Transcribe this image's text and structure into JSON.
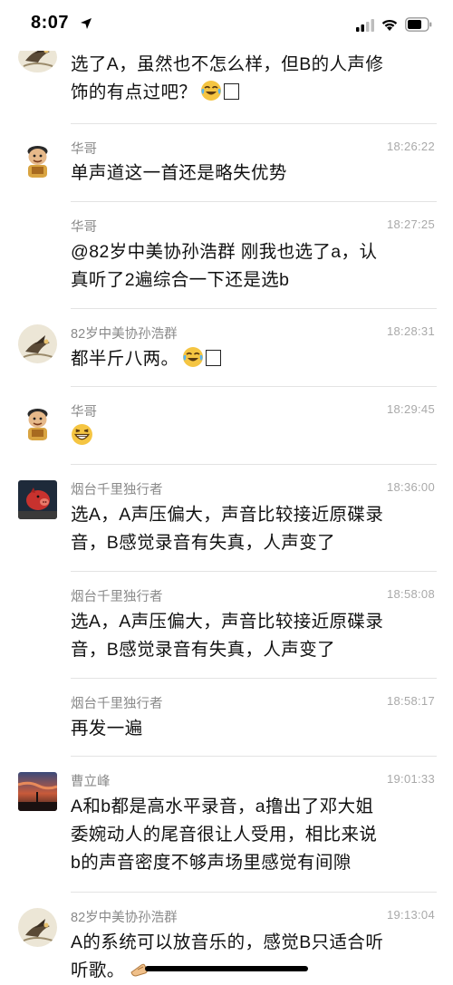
{
  "status_bar": {
    "time": "8:07"
  },
  "messages": [
    {
      "sender": "",
      "time": "",
      "lines": [
        "选了A，虽然也不怎么样，但B的人声修",
        "饰的有点过吧？"
      ],
      "avatar": "bird-avatar",
      "trail": [
        "crying-laughing-emoji",
        "box-glyph"
      ]
    },
    {
      "sender": "华哥",
      "time": "18:26:22",
      "lines": [
        "单声道这一首还是略失优势"
      ],
      "avatar": "cartoon-man-avatar"
    },
    {
      "sender": "华哥",
      "time": "18:27:25",
      "lines": [
        "@82岁中美协孙浩群 刚我也选了a，认",
        "真听了2遍综合一下还是选b"
      ],
      "avatar": ""
    },
    {
      "sender": "82岁中美协孙浩群",
      "time": "18:28:31",
      "lines": [
        "都半斤八两。"
      ],
      "avatar": "bird-avatar",
      "trail": [
        "crying-laughing-emoji",
        "box-glyph"
      ]
    },
    {
      "sender": "华哥",
      "time": "18:29:45",
      "lines": [
        ""
      ],
      "avatar": "cartoon-man-avatar",
      "trail": [
        "grinning-emoji"
      ]
    },
    {
      "sender": "烟台千里独行者",
      "time": "18:36:00",
      "lines": [
        "选A，A声压偏大，声音比较接近原碟录",
        "音，B感觉录音有失真，人声变了"
      ],
      "avatar": "pig-avatar"
    },
    {
      "sender": "烟台千里独行者",
      "time": "18:58:08",
      "lines": [
        "选A，A声压偏大，声音比较接近原碟录",
        "音，B感觉录音有失真，人声变了"
      ],
      "avatar": ""
    },
    {
      "sender": "烟台千里独行者",
      "time": "18:58:17",
      "lines": [
        "再发一遍"
      ],
      "avatar": ""
    },
    {
      "sender": "曹立峰",
      "time": "19:01:33",
      "lines": [
        "A和b都是高水平录音，a撸出了邓大姐",
        "委婉动人的尾音很让人受用，相比来说",
        "b的声音密度不够声场里感觉有间隙"
      ],
      "avatar": "sunset-avatar"
    },
    {
      "sender": "82岁中美协孙浩群",
      "time": "19:13:04",
      "lines": [
        "A的系统可以放音乐的，感觉B只适合听",
        "听歌。"
      ],
      "avatar": "bird-avatar",
      "trail": [
        "hand-emoji"
      ]
    }
  ],
  "colors": {
    "sender": "#8a8a8a",
    "time": "#a9a9a9",
    "divider": "#e3e3e3",
    "text": "#111111"
  }
}
